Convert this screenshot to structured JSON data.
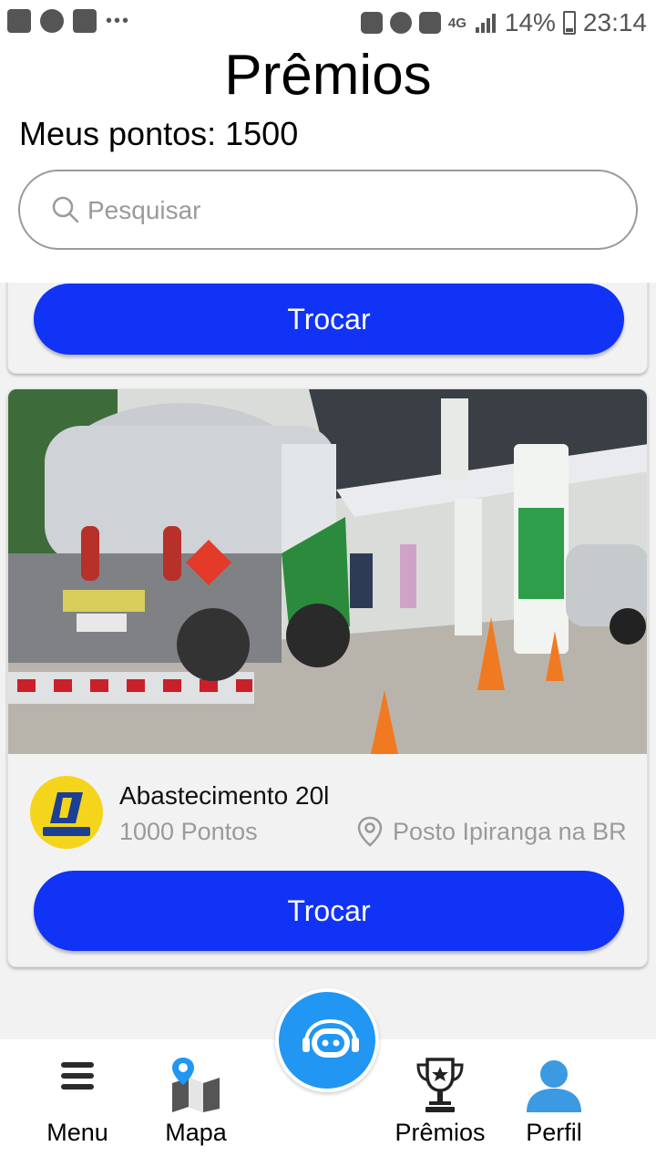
{
  "status_bar": {
    "network": "4G",
    "battery": "14%",
    "time": "23:14",
    "icons": [
      "gallery-icon",
      "arch-icon",
      "youtube-icon",
      "more-dots-icon",
      "mute-icon",
      "alarm-icon",
      "shield-icon",
      "signal-icon",
      "battery-icon"
    ]
  },
  "header": {
    "title": "Prêmios",
    "points_label": "Meus pontos: 1500"
  },
  "search": {
    "placeholder": "Pesquisar",
    "icon": "search-icon"
  },
  "rewards": [
    {
      "button_label": "Trocar"
    },
    {
      "title": "Abastecimento 20l",
      "points": "1000 Pontos",
      "location": "Posto Ipiranga na BR",
      "logo_text": "Ipiranga",
      "button_label": "Trocar"
    }
  ],
  "bottom_nav": {
    "items": [
      {
        "label": "Menu",
        "icon": "menu-icon"
      },
      {
        "label": "Mapa",
        "icon": "map-icon"
      },
      {
        "label": "Prêmios",
        "icon": "trophy-icon"
      },
      {
        "label": "Perfil",
        "icon": "user-icon"
      }
    ],
    "fab_icon": "chatbot-icon"
  },
  "colors": {
    "primary_button": "#1133f5",
    "fab": "#2196f3",
    "content_background": "#f2f2f2",
    "muted_text": "#9a9a9a",
    "profile_icon": "#3b9ae1"
  }
}
